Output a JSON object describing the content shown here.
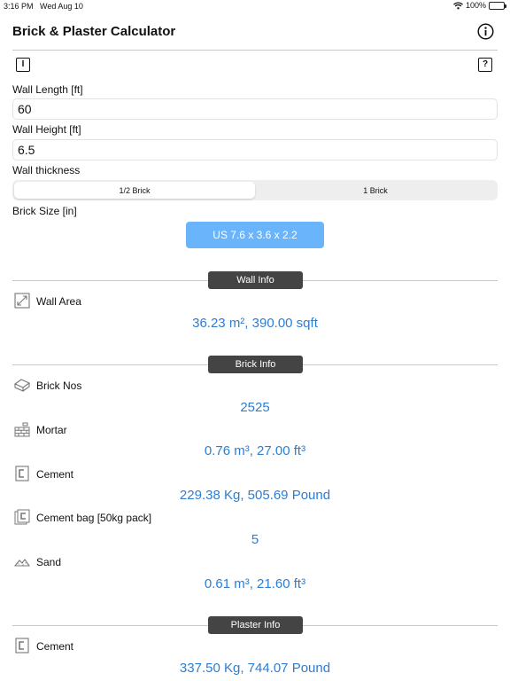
{
  "status_bar": {
    "time": "3:16 PM",
    "date": "Wed Aug 10",
    "battery": "100%"
  },
  "nav": {
    "title": "Brick & Plaster Calculator"
  },
  "toolbar": {
    "left_icon_glyph": "I",
    "right_icon_glyph": "?"
  },
  "inputs": {
    "wall_length": {
      "label": "Wall Length [ft]",
      "value": "60"
    },
    "wall_height": {
      "label": "Wall Height [ft]",
      "value": "6.5"
    }
  },
  "wall_thickness": {
    "label": "Wall thickness",
    "options": [
      "1/2 Brick",
      "1 Brick"
    ],
    "selected": "1/2 Brick"
  },
  "brick_size": {
    "label": "Brick Size [in]",
    "button": "US 7.6 x 3.6 x 2.2"
  },
  "sections": {
    "wall_info": {
      "title": "Wall Info",
      "rows": [
        {
          "label": "Wall Area",
          "value": "36.23 m², 390.00 sqft",
          "icon": "expand-icon"
        }
      ]
    },
    "brick_info": {
      "title": "Brick Info",
      "rows": [
        {
          "label": "Brick Nos",
          "value": "2525",
          "icon": "brick-icon"
        },
        {
          "label": "Mortar",
          "value": "0.76 m³, 27.00 ft³",
          "icon": "brick-wall-icon"
        },
        {
          "label": "Cement",
          "value": "229.38 Kg, 505.69 Pound",
          "icon": "cement-icon"
        },
        {
          "label": "Cement bag [50kg pack]",
          "value": "5",
          "icon": "cement-bag-icon"
        },
        {
          "label": "Sand",
          "value": "0.61 m³, 21.60 ft³",
          "icon": "sand-icon"
        }
      ]
    },
    "plaster_info": {
      "title": "Plaster Info",
      "rows": [
        {
          "label": "Cement",
          "value": "337.50 Kg, 744.07 Pound",
          "icon": "cement-icon"
        }
      ]
    }
  },
  "colors": {
    "accent_value": "#2d7dd2",
    "button_blue": "#6ab4fc",
    "section_pill": "#444444"
  }
}
